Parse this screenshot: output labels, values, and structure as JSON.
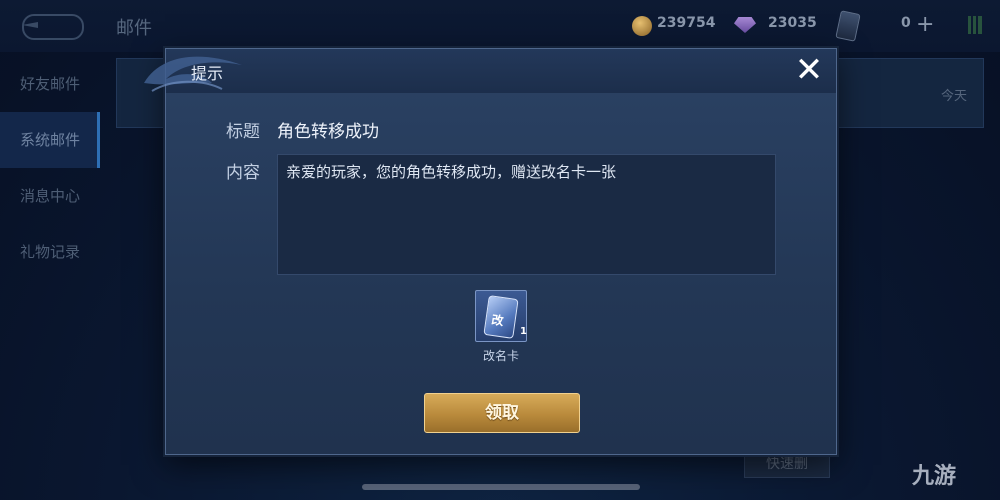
{
  "screen": {
    "title": "邮件"
  },
  "resources": {
    "gold": "239754",
    "gems": "23035",
    "cards": "0"
  },
  "sidebar": {
    "items": [
      {
        "label": "好友邮件"
      },
      {
        "label": "系统邮件"
      },
      {
        "label": "消息中心"
      },
      {
        "label": "礼物记录"
      }
    ]
  },
  "mail_list": {
    "date": "今天",
    "quick_button": "快速删"
  },
  "dialog": {
    "title": "提示",
    "subject_label": "标题",
    "subject_value": "角色转移成功",
    "content_label": "内容",
    "content_text": "亲爱的玩家，您的角色转移成功，赠送改名卡一张",
    "item": {
      "name": "改名卡",
      "count": "1",
      "icon_char": "改"
    },
    "claim_label": "领取"
  },
  "watermark": "九游",
  "colors": {
    "gold_button": "#c69545",
    "dialog_bg": "#263a5a"
  }
}
